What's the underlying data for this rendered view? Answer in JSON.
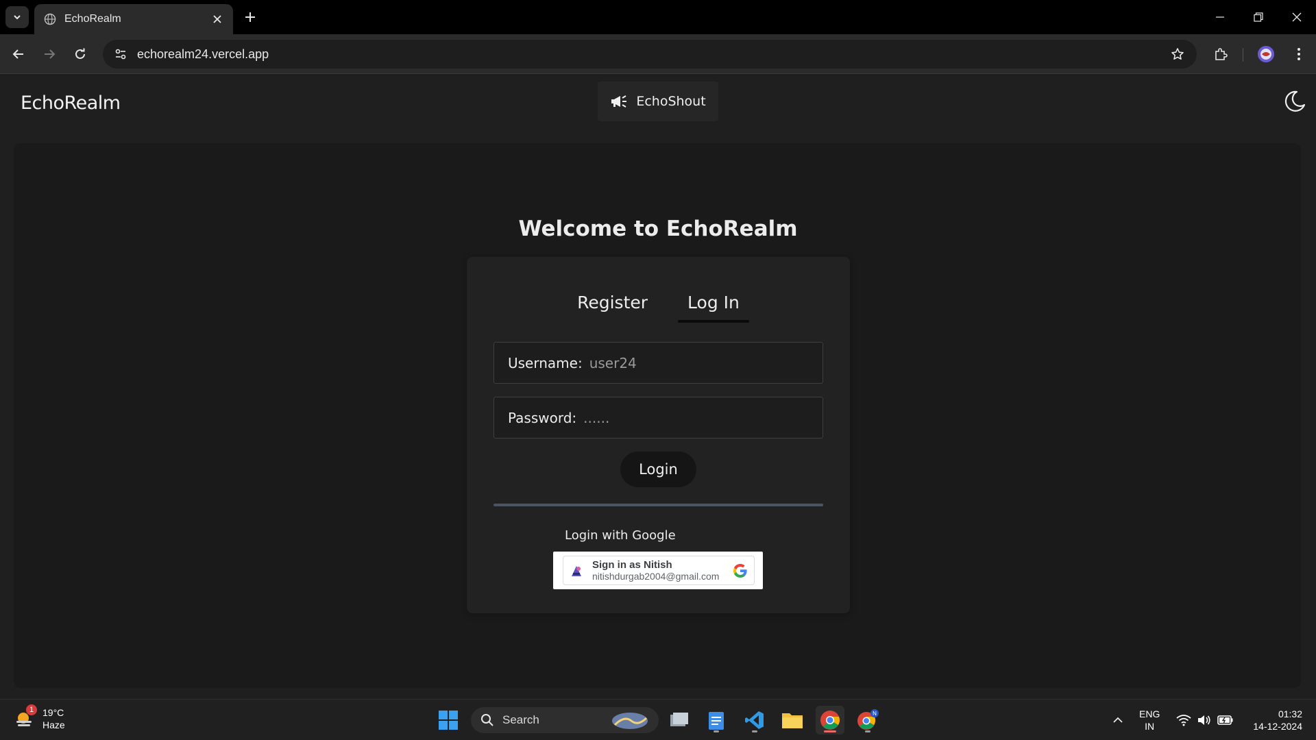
{
  "browser": {
    "tab_title": "EchoRealm",
    "url": "echorealm24.vercel.app"
  },
  "header": {
    "brand": "EchoRealm",
    "echo_shout_label": "EchoShout"
  },
  "main": {
    "welcome": "Welcome to EchoRealm",
    "tabs": [
      {
        "label": "Register",
        "active": false
      },
      {
        "label": "Log In",
        "active": true
      }
    ],
    "username_label": "Username:",
    "username_value": "user24",
    "password_label": "Password:",
    "password_value": "......",
    "login_button": "Login",
    "google_label": "Login with Google",
    "google_signin": {
      "name": "Sign in as Nitish",
      "email": "nitishdurgab2004@gmail.com"
    }
  },
  "taskbar": {
    "weather_temp": "19°C",
    "weather_desc": "Haze",
    "weather_badge": "1",
    "search_label": "Search",
    "lang_line1": "ENG",
    "lang_line2": "IN",
    "time": "01:32",
    "date": "14-12-2024"
  },
  "colors": {
    "page_bg": "#1f1f1f",
    "panel_bg": "#1a1a1a",
    "card_bg": "#222222",
    "divider": "#4a5564"
  }
}
